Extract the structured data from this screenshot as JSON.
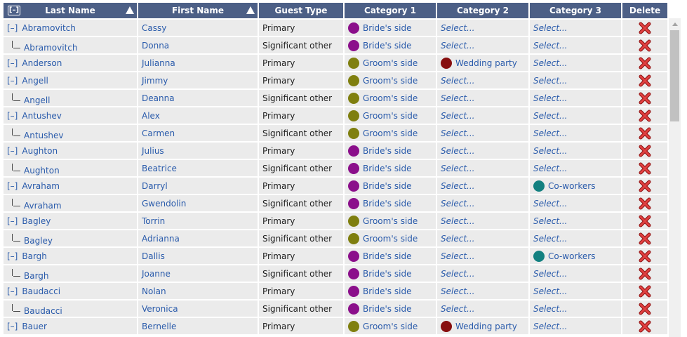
{
  "colors": {
    "header_bg": "#4c5f86",
    "brides_side": "#8b0f8b",
    "grooms_side": "#7f7f0f",
    "wedding_party": "#870e0e",
    "co_workers": "#128080"
  },
  "header": {
    "toggle_label": "[–]",
    "last_name": "Last Name",
    "first_name": "First Name",
    "guest_type": "Guest Type",
    "category1": "Category 1",
    "category2": "Category 2",
    "category3": "Category 3",
    "delete": "Delete"
  },
  "labels": {
    "toggle": "[–]",
    "select": "Select..."
  },
  "rows": [
    {
      "last": "Abramovitch",
      "first": "Cassy",
      "type": "Primary",
      "child": false,
      "cat1": "Bride's side",
      "cat2": "",
      "cat3": ""
    },
    {
      "last": "Abramovitch",
      "first": "Donna",
      "type": "Significant other",
      "child": true,
      "cat1": "Bride's side",
      "cat2": "",
      "cat3": ""
    },
    {
      "last": "Anderson",
      "first": "Julianna",
      "type": "Primary",
      "child": false,
      "cat1": "Groom's side",
      "cat2": "Wedding party",
      "cat3": ""
    },
    {
      "last": "Angell",
      "first": "Jimmy",
      "type": "Primary",
      "child": false,
      "cat1": "Groom's side",
      "cat2": "",
      "cat3": ""
    },
    {
      "last": "Angell",
      "first": "Deanna",
      "type": "Significant other",
      "child": true,
      "cat1": "Groom's side",
      "cat2": "",
      "cat3": ""
    },
    {
      "last": "Antushev",
      "first": "Alex",
      "type": "Primary",
      "child": false,
      "cat1": "Groom's side",
      "cat2": "",
      "cat3": ""
    },
    {
      "last": "Antushev",
      "first": "Carmen",
      "type": "Significant other",
      "child": true,
      "cat1": "Groom's side",
      "cat2": "",
      "cat3": ""
    },
    {
      "last": "Aughton",
      "first": "Julius",
      "type": "Primary",
      "child": false,
      "cat1": "Bride's side",
      "cat2": "",
      "cat3": ""
    },
    {
      "last": "Aughton",
      "first": "Beatrice",
      "type": "Significant other",
      "child": true,
      "cat1": "Bride's side",
      "cat2": "",
      "cat3": ""
    },
    {
      "last": "Avraham",
      "first": "Darryl",
      "type": "Primary",
      "child": false,
      "cat1": "Bride's side",
      "cat2": "",
      "cat3": "Co-workers"
    },
    {
      "last": "Avraham",
      "first": "Gwendolin",
      "type": "Significant other",
      "child": true,
      "cat1": "Bride's side",
      "cat2": "",
      "cat3": ""
    },
    {
      "last": "Bagley",
      "first": "Torrin",
      "type": "Primary",
      "child": false,
      "cat1": "Groom's side",
      "cat2": "",
      "cat3": ""
    },
    {
      "last": "Bagley",
      "first": "Adrianna",
      "type": "Significant other",
      "child": true,
      "cat1": "Groom's side",
      "cat2": "",
      "cat3": ""
    },
    {
      "last": "Bargh",
      "first": "Dallis",
      "type": "Primary",
      "child": false,
      "cat1": "Bride's side",
      "cat2": "",
      "cat3": "Co-workers"
    },
    {
      "last": "Bargh",
      "first": "Joanne",
      "type": "Significant other",
      "child": true,
      "cat1": "Bride's side",
      "cat2": "",
      "cat3": ""
    },
    {
      "last": "Baudacci",
      "first": "Nolan",
      "type": "Primary",
      "child": false,
      "cat1": "Bride's side",
      "cat2": "",
      "cat3": ""
    },
    {
      "last": "Baudacci",
      "first": "Veronica",
      "type": "Significant other",
      "child": true,
      "cat1": "Bride's side",
      "cat2": "",
      "cat3": ""
    },
    {
      "last": "Bauer",
      "first": "Bernelle",
      "type": "Primary",
      "child": false,
      "cat1": "Groom's side",
      "cat2": "Wedding party",
      "cat3": ""
    }
  ]
}
